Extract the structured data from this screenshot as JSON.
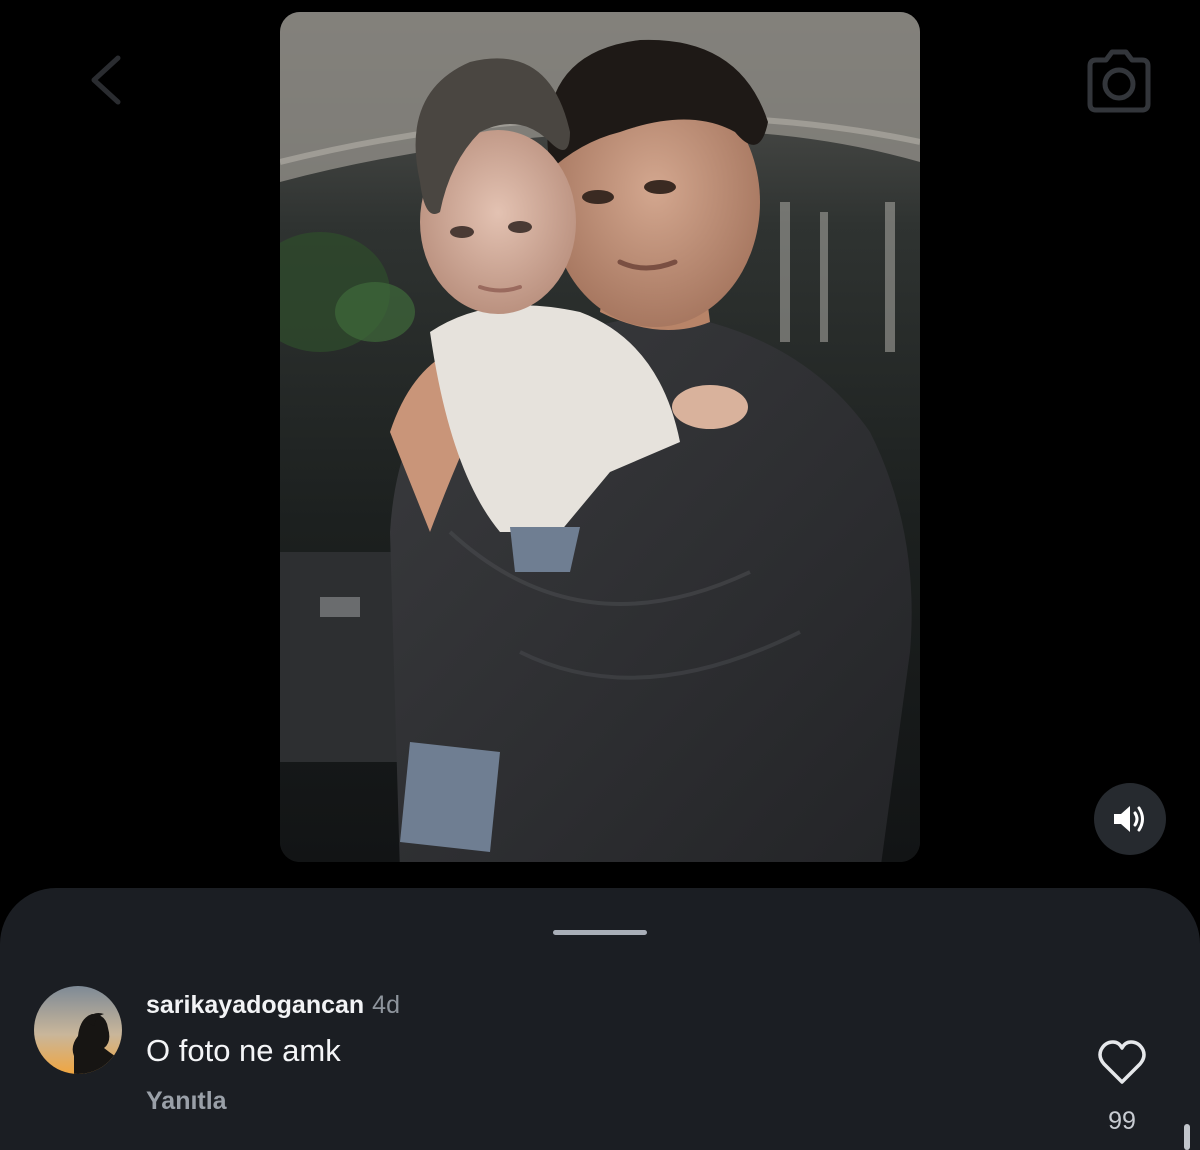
{
  "header": {
    "back_icon": "chevron-left-icon",
    "camera_icon": "camera-icon"
  },
  "media": {
    "description_icon": "photo",
    "sound_icon": "speaker-on-icon"
  },
  "comment_sheet": {
    "comment": {
      "username": "sarikayadogancan",
      "time_ago": "4d",
      "text": "O foto ne amk",
      "reply_label": "Yanıtla",
      "like_count": "99"
    }
  },
  "colors": {
    "background": "#000000",
    "sheet": "#1b1e23",
    "primary_text": "#f2f3f5",
    "secondary_text": "#8e949c"
  }
}
